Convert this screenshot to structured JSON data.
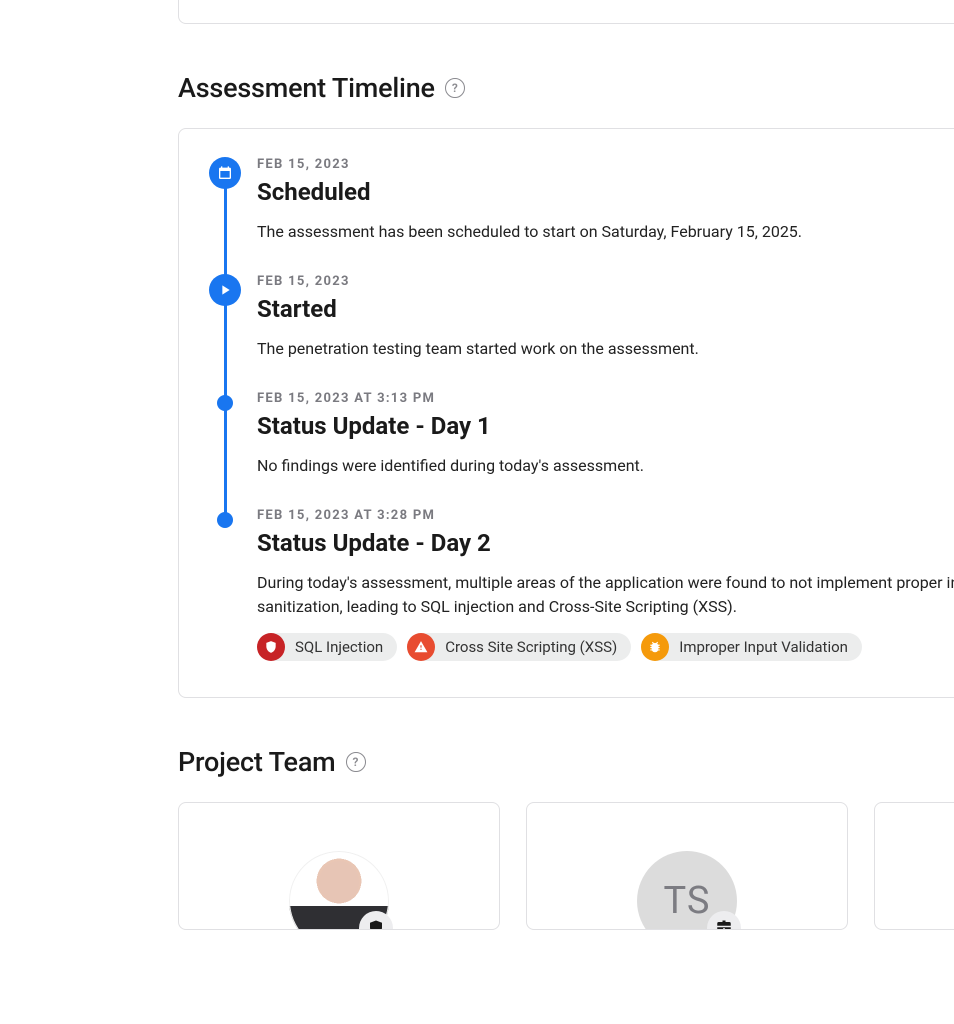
{
  "sections": {
    "timeline_title": "Assessment Timeline",
    "team_title": "Project Team"
  },
  "timeline": [
    {
      "marker": "calendar",
      "date": "FEB 15, 2023",
      "title": "Scheduled",
      "body": "The assessment has been scheduled to start on Saturday, February 15, 2025.",
      "tags": []
    },
    {
      "marker": "play",
      "date": "FEB 15, 2023",
      "title": "Started",
      "body": "The penetration testing team started work on the assessment.",
      "tags": []
    },
    {
      "marker": "dot",
      "date": "FEB 15, 2023 AT 3:13 PM",
      "title": "Status Update - Day 1",
      "body": "No findings were identified during today's assessment.",
      "tags": []
    },
    {
      "marker": "dot",
      "date": "FEB 15, 2023 AT 3:28 PM",
      "title": "Status Update - Day 2",
      "body": "During today's assessment, multiple areas of the application were found to not implement proper input sanitization, leading to SQL injection and Cross-Site Scripting (XSS).",
      "tags": [
        {
          "label": "SQL Injection",
          "severity": "critical",
          "icon": "shield"
        },
        {
          "label": "Cross Site Scripting (XSS)",
          "severity": "high",
          "icon": "warning"
        },
        {
          "label": "Improper Input Validation",
          "severity": "medium",
          "icon": "bug"
        }
      ]
    }
  ],
  "team": [
    {
      "type": "photo",
      "badge": "shield"
    },
    {
      "type": "initials",
      "initials": "TS",
      "badge": "briefcase"
    },
    {
      "type": "placeholder"
    }
  ],
  "severity_colors": {
    "critical": "#c72326",
    "high": "#e84c30",
    "medium": "#f59a0b"
  }
}
